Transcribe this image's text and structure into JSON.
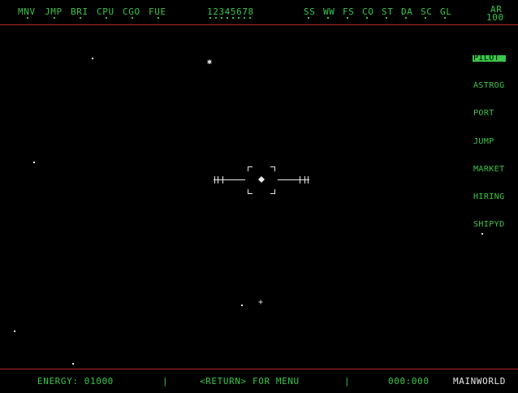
{
  "header": {
    "systems": [
      "MNV",
      "JMP",
      "BRI",
      "CPU",
      "CGO",
      "FUE"
    ],
    "counter": "12345678",
    "subsystems": [
      "SS",
      "WW",
      "FS",
      "CO",
      "ST",
      "DA",
      "SC",
      "GL"
    ],
    "ar_label": "AR",
    "ar_value": "100"
  },
  "menu": {
    "items": [
      "PILOT",
      "ASTROG",
      "PORT",
      "JUMP",
      "MARKET",
      "HIRING",
      "SHIPYD"
    ],
    "selected": "PILOT"
  },
  "footer": {
    "energy": "ENERGY: 01000",
    "sep1": "|",
    "prompt": "<RETURN> FOR MENU",
    "sep2": "|",
    "time": "000:000",
    "location": "MAINWORLD"
  },
  "colors": {
    "text": "#39c64a",
    "divider": "#b0262a",
    "stars": "#e8e8e8",
    "background": "#000000"
  }
}
